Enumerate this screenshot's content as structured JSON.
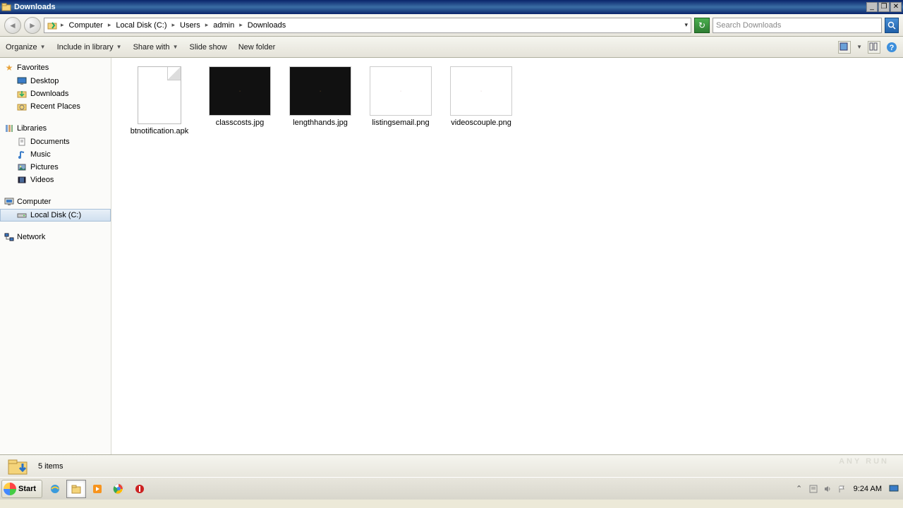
{
  "window": {
    "title": "Downloads"
  },
  "breadcrumb": [
    "Computer",
    "Local Disk (C:)",
    "Users",
    "admin",
    "Downloads"
  ],
  "search": {
    "placeholder": "Search Downloads"
  },
  "commands": {
    "organize": "Organize",
    "include": "Include in library",
    "share": "Share with",
    "slideshow": "Slide show",
    "newfolder": "New folder"
  },
  "sidebar": {
    "favorites": {
      "label": "Favorites",
      "items": [
        "Desktop",
        "Downloads",
        "Recent Places"
      ]
    },
    "libraries": {
      "label": "Libraries",
      "items": [
        "Documents",
        "Music",
        "Pictures",
        "Videos"
      ]
    },
    "computer": {
      "label": "Computer",
      "items": [
        "Local Disk (C:)"
      ],
      "selected": 0
    },
    "network": {
      "label": "Network"
    }
  },
  "files": [
    {
      "name": "btnotification.apk",
      "kind": "doc"
    },
    {
      "name": "classcosts.jpg",
      "kind": "dark"
    },
    {
      "name": "lengthhands.jpg",
      "kind": "dark"
    },
    {
      "name": "listingsemail.png",
      "kind": "light"
    },
    {
      "name": "videoscouple.png",
      "kind": "light"
    }
  ],
  "status": {
    "text": "5 items"
  },
  "taskbar": {
    "start": "Start",
    "clock": "9:24 AM"
  },
  "watermark": "ANY     RUN"
}
